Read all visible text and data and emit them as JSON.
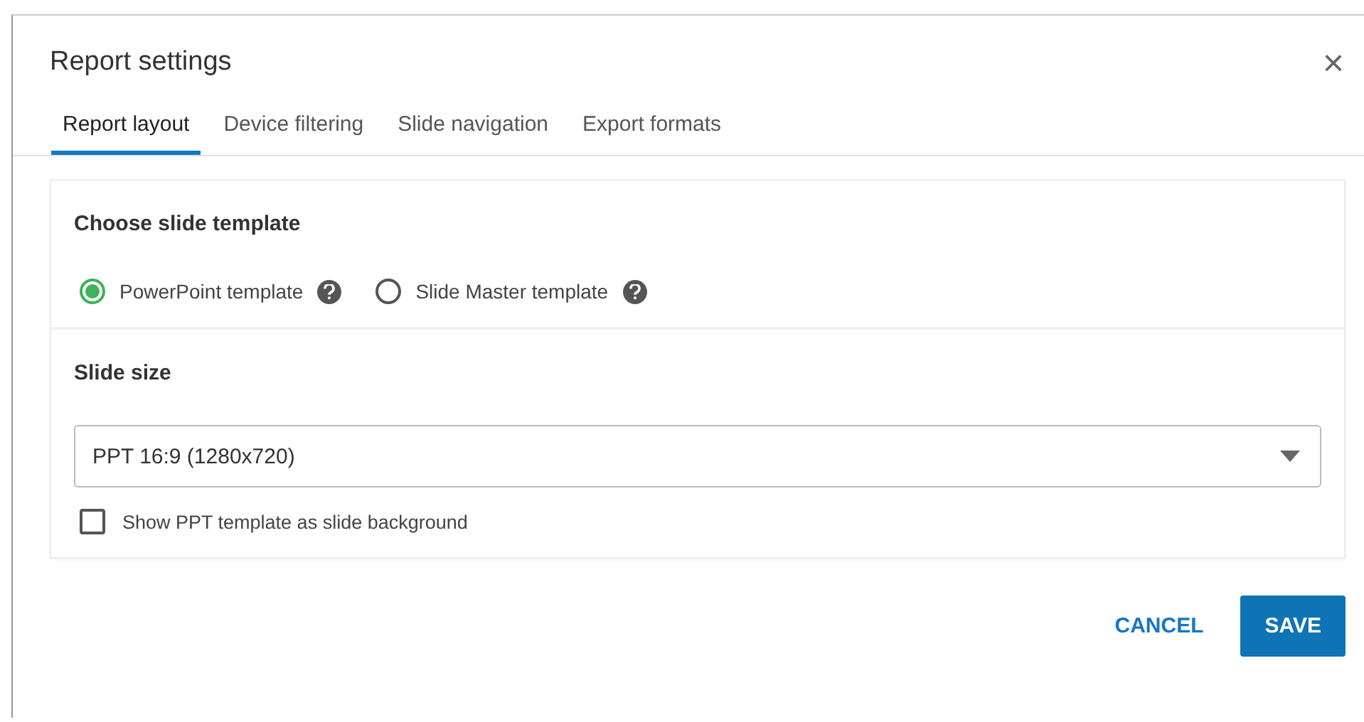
{
  "dialog": {
    "title": "Report settings",
    "close": "×"
  },
  "tabs": [
    {
      "label": "Report layout",
      "selected": true
    },
    {
      "label": "Device filtering",
      "selected": false
    },
    {
      "label": "Slide navigation",
      "selected": false
    },
    {
      "label": "Export formats",
      "selected": false
    }
  ],
  "template_section": {
    "heading": "Choose slide template",
    "options": [
      {
        "label": "PowerPoint template",
        "selected": true
      },
      {
        "label": "Slide Master template",
        "selected": false
      }
    ]
  },
  "size_section": {
    "heading": "Slide size",
    "select": {
      "value": "PPT 16:9 (1280x720)"
    },
    "checkbox": {
      "label": "Show PPT template as slide background",
      "checked": false
    }
  },
  "buttons": [
    {
      "label": "CANCEL",
      "kind": "text"
    },
    {
      "label": "SAVE",
      "kind": "primary"
    }
  ]
}
